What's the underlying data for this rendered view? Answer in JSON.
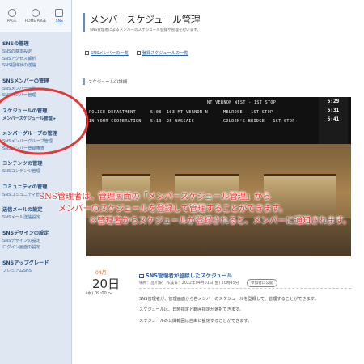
{
  "topnav": [
    {
      "label": "PAGE"
    },
    {
      "label": "HOME PAGE"
    },
    {
      "label": "SNS"
    }
  ],
  "sidebar": [
    {
      "title": "SNSの管理",
      "items": [
        "SNSの基本設定",
        "SNSアクセス解析",
        "SNS招待状の送信"
      ]
    },
    {
      "title": "SNSメンバーの管理",
      "items": [
        "SNSメンバー一覧",
        "SNSメンバー管理"
      ]
    },
    {
      "title": "スケジュールの管理",
      "items": [
        "メンバースケジュール管理 ▸"
      ]
    },
    {
      "title": "メンバーグループの管理",
      "items": [
        "SNSメンバーグループ管理",
        "SNSメンバー登録審査"
      ]
    },
    {
      "title": "コンテンツの管理",
      "items": [
        "SNSコンテンツ管理"
      ]
    },
    {
      "title": "コミュニティの管理",
      "items": [
        "SNSコミュニティ管理"
      ]
    },
    {
      "title": "送信メールの設定",
      "items": [
        "SNSメール送信設定"
      ]
    },
    {
      "title": "SNSデザインの設定",
      "items": [
        "SNSデザインの設定",
        "ログイン画面の設定"
      ]
    },
    {
      "title": "SNSアップグレード",
      "items": [
        "プレミアムSNS"
      ]
    }
  ],
  "header": {
    "title": "メンバースケジュール管理",
    "subtitle": "SNS管理者によるメンバーのスケジュール登録や管理を行います。"
  },
  "links": [
    "SNSメンバーの一覧",
    "登録スケジュールの一覧"
  ],
  "section": {
    "heading": "スケジュールの詳細"
  },
  "photo": {
    "board_rows": [
      [
        "POLICE DEPARTMENT",
        "5:08",
        "103 MT VERNON N",
        "MELROSE - 1ST STOP"
      ],
      [
        "IN YOUR COOPERATION",
        "5:13",
        "25 WASSAIC",
        "GOLDEN'S BRIDGE - 1ST STOP"
      ],
      [
        "",
        "",
        "",
        ""
      ]
    ],
    "board_top_right": [
      "NT VERNON WEST - 1ST STOP"
    ],
    "times": [
      "5:29",
      "5:31",
      "5:41"
    ]
  },
  "overlay": {
    "line1": "SNS管理者は、管理画面の「メンバースケジュール管理」から",
    "line2": "メンバーのスケジュールを登録して管理することができます。",
    "line3": "※管理者からスケジュールが登録されると、メンバーに通知されます。",
    "color": "#e03a3a"
  },
  "event": {
    "month": "04月",
    "day": "20日",
    "time": "(水) 09:00 ～",
    "title": "SNS管理者が登録したスケジュール",
    "meta": "場所：品川駅　作成日：2022年04月01日(金) 20時45分",
    "badge": "参加者に公開",
    "body": [
      "SNS管理者が、管理画面から各メンバーのスケジュールを登録して、管理することができます。",
      "スケジュールは、日時指定と範囲指定が選択できます。",
      "スケジュールの公開範囲は自由に設定することができます。"
    ]
  }
}
